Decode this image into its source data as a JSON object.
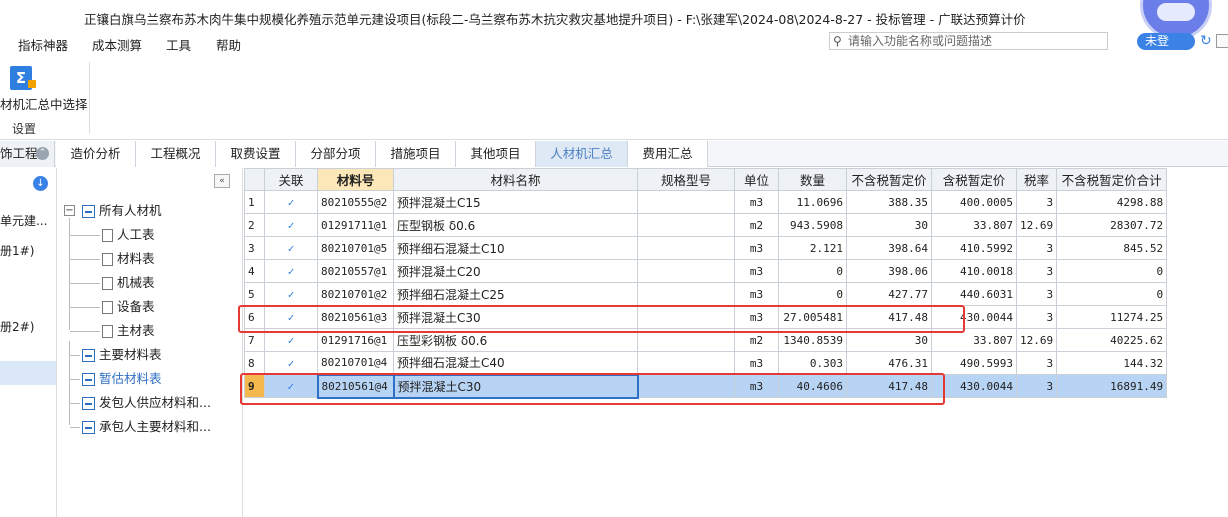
{
  "window": {
    "title": "正镶白旗乌兰察布苏木肉牛集中规模化养殖示范单元建设项目(标段二-乌兰察布苏木抗灾救灾基地提升项目)  - F:\\张建军\\2024-08\\2024-8-27 - 投标管理 - 广联达预算计价"
  },
  "menu": {
    "items": [
      "指标神器",
      "成本测算",
      "工具",
      "帮助"
    ],
    "search_placeholder": "请输入功能名称或问题描述",
    "login_label": "未登"
  },
  "ribbon": {
    "button_label": "材机汇总中选择",
    "group_label": "设置"
  },
  "tabs": {
    "first": "饰工程",
    "items": [
      "造价分析",
      "工程概况",
      "取费设置",
      "分部分项",
      "措施项目",
      "其他项目",
      "人材机汇总",
      "费用汇总"
    ],
    "active": "人材机汇总"
  },
  "left": {
    "items": [
      "单元建...",
      "册1#)",
      "册2#)"
    ]
  },
  "tree": {
    "root": "所有人材机",
    "children": [
      "人工表",
      "材料表",
      "机械表",
      "设备表",
      "主材表"
    ],
    "others": [
      "主要材料表",
      "暂估材料表",
      "发包人供应材料和...",
      "承包人主要材料和..."
    ]
  },
  "grid": {
    "columns": [
      "",
      "关联",
      "材料号",
      "材料名称",
      "规格型号",
      "单位",
      "数量",
      "不含税暂定价",
      "含税暂定价",
      "税率",
      "不含税暂定价合计"
    ],
    "rows": [
      {
        "no": "1",
        "link": "✓",
        "code": "80210555@2",
        "name": "预拌混凝土C15",
        "spec": "",
        "unit": "m3",
        "qty": "11.0696",
        "price": "388.35",
        "price_tax": "400.0005",
        "rate": "3",
        "total": "4298.88"
      },
      {
        "no": "2",
        "link": "✓",
        "code": "01291711@1",
        "name": "压型钢板 δ0.6",
        "spec": "",
        "unit": "m2",
        "qty": "943.5908",
        "price": "30",
        "price_tax": "33.807",
        "rate": "12.69",
        "total": "28307.72"
      },
      {
        "no": "3",
        "link": "✓",
        "code": "80210701@5",
        "name": "预拌细石混凝土C10",
        "spec": "",
        "unit": "m3",
        "qty": "2.121",
        "price": "398.64",
        "price_tax": "410.5992",
        "rate": "3",
        "total": "845.52"
      },
      {
        "no": "4",
        "link": "✓",
        "code": "80210557@1",
        "name": "预拌混凝土C20",
        "spec": "",
        "unit": "m3",
        "qty": "0",
        "price": "398.06",
        "price_tax": "410.0018",
        "rate": "3",
        "total": "0"
      },
      {
        "no": "5",
        "link": "✓",
        "code": "80210701@2",
        "name": "预拌细石混凝土C25",
        "spec": "",
        "unit": "m3",
        "qty": "0",
        "price": "427.77",
        "price_tax": "440.6031",
        "rate": "3",
        "total": "0"
      },
      {
        "no": "6",
        "link": "✓",
        "code": "80210561@3",
        "name": "预拌混凝土C30",
        "spec": "",
        "unit": "m3",
        "qty": "27.005481",
        "price": "417.48",
        "price_tax": "430.0044",
        "rate": "3",
        "total": "11274.25"
      },
      {
        "no": "7",
        "link": "✓",
        "code": "01291716@1",
        "name": "压型彩钢板 δ0.6",
        "spec": "",
        "unit": "m2",
        "qty": "1340.8539",
        "price": "30",
        "price_tax": "33.807",
        "rate": "12.69",
        "total": "40225.62"
      },
      {
        "no": "8",
        "link": "✓",
        "code": "80210701@4",
        "name": "预拌细石混凝土C40",
        "spec": "",
        "unit": "m3",
        "qty": "0.303",
        "price": "476.31",
        "price_tax": "490.5993",
        "rate": "3",
        "total": "144.32"
      },
      {
        "no": "9",
        "link": "✓",
        "code": "80210561@4",
        "name": "预拌混凝土C30",
        "spec": "",
        "unit": "m3",
        "qty": "40.4606",
        "price": "417.48",
        "price_tax": "430.0044",
        "rate": "3",
        "total": "16891.49"
      }
    ],
    "selected_row": "9"
  },
  "colors": {
    "accent": "#2f7fe0",
    "highlight_box": "#e53935",
    "selected_row": "#b8d4f5",
    "header_active": "#fbe7b7"
  }
}
